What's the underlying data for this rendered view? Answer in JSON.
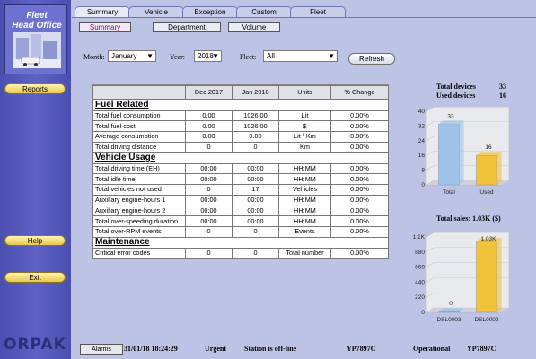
{
  "app": {
    "logo_title_line1": "Fleet",
    "logo_title_line2": "Head Office",
    "brand": "ORPAK"
  },
  "sidebar": {
    "reports_label": "Reports",
    "help_label": "Help",
    "exit_label": "Exit"
  },
  "tabs": [
    {
      "label": "Summary",
      "active": true
    },
    {
      "label": "Vehicle",
      "active": false
    },
    {
      "label": "Exception",
      "active": false
    },
    {
      "label": "Custom",
      "active": false
    },
    {
      "label": "Fleet",
      "active": false
    }
  ],
  "subtabs": {
    "summary": "Summary",
    "department": "Department",
    "volume": "Volume"
  },
  "filters": {
    "month_label": "Month:",
    "month_value": "January",
    "year_label": "Year:",
    "year_value": "2018",
    "fleet_label": "Fleet:",
    "fleet_value": "All",
    "refresh_label": "Refresh"
  },
  "table": {
    "headers": [
      "",
      "Dec 2017",
      "Jan 2018",
      "Units",
      "% Change"
    ],
    "sections": [
      {
        "title": "Fuel Related",
        "rows": [
          [
            "Total fuel consumption",
            "0.00",
            "1026.00",
            "Lit",
            "0.00%"
          ],
          [
            "Total fuel cost",
            "0.00",
            "1026.00",
            "$",
            "0.00%"
          ],
          [
            "Average consumption",
            "0.00",
            "0.00",
            "Lit / Km",
            "0.00%"
          ],
          [
            "Total driving distance",
            "0",
            "0",
            "Km",
            "0.00%"
          ]
        ]
      },
      {
        "title": "Vehicle Usage",
        "rows": [
          [
            "Total driving time (EH)",
            "00:00",
            "00:00",
            "HH:MM",
            "0.00%"
          ],
          [
            "Total idle time",
            "00:00",
            "00:00",
            "HH:MM",
            "0.00%"
          ],
          [
            "Total vehicles not used",
            "0",
            "17",
            "Vehicles",
            "0.00%"
          ],
          [
            "Auxiliary engine-hours 1",
            "00:00",
            "00:00",
            "HH:MM",
            "0.00%"
          ],
          [
            "Auxiliary engine-hours 2",
            "00:00",
            "00:00",
            "HH:MM",
            "0.00%"
          ],
          [
            "Total over-speeding duration",
            "00:00",
            "00:00",
            "HH:MM",
            "0.00%"
          ],
          [
            "Total over-RPM events",
            "0",
            "0",
            "Events",
            "0.00%"
          ]
        ]
      },
      {
        "title": "Maintenance",
        "rows": [
          [
            "Critical error codes",
            "0",
            "0",
            "Total number",
            "0.00%"
          ]
        ]
      }
    ]
  },
  "devices": {
    "total_label": "Total devices",
    "total_value": "33",
    "used_label": "Used devices",
    "used_value": "16"
  },
  "sales": {
    "title": "Total sales: 1.03K ($)"
  },
  "chart_data": [
    {
      "type": "bar",
      "title": "",
      "categories": [
        "Total",
        "Used"
      ],
      "values": [
        33,
        16
      ],
      "ylim": [
        0,
        40
      ],
      "yticks": [
        "0",
        "8",
        "16",
        "24",
        "32",
        "40"
      ],
      "data_labels": [
        "33",
        "16"
      ],
      "colors": [
        "#9fc3e8",
        "#f2c23a"
      ]
    },
    {
      "type": "bar",
      "title": "",
      "categories": [
        "DSL0003",
        "DSL0002"
      ],
      "values": [
        10,
        1030
      ],
      "ylim": [
        0,
        1100
      ],
      "yticks": [
        "0",
        "220",
        "440",
        "660",
        "880",
        "1.1K"
      ],
      "data_labels": [
        "0",
        "1.03K"
      ],
      "colors": [
        "#9fc3e8",
        "#f2c23a"
      ]
    }
  ],
  "status": {
    "alarms_label": "Alarms",
    "timestamp": "31/01/18 18:24:29",
    "priority": "Urgent",
    "message": "Station is off-line",
    "vehicle_id": "YP7897C",
    "state": "Operational",
    "vehicle_id_2": "YP7897C"
  }
}
